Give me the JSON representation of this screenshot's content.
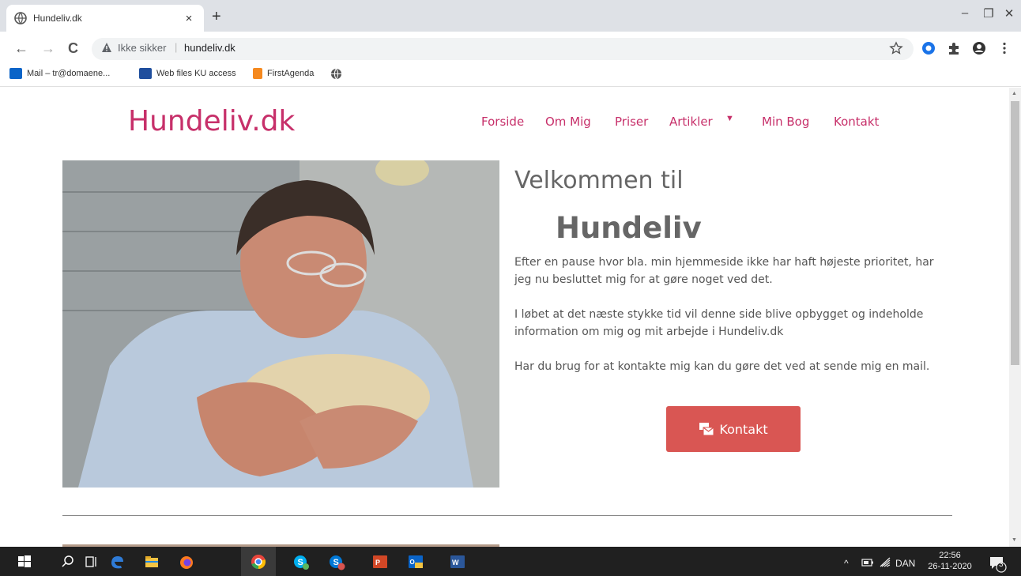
{
  "browser": {
    "tab_title": "Hundeliv.dk",
    "tab_close": "×",
    "new_tab": "+",
    "window_controls": [
      "–",
      "❐",
      "✕"
    ],
    "nav": {
      "back": "←",
      "forward": "→",
      "reload": "C"
    },
    "security_label": "Ikke sikker",
    "url_separator": "|",
    "url": "hundeliv.dk",
    "bookmarks": [
      {
        "label": "Mail – tr@domaene...",
        "icon": "outlook-icon",
        "color": "#0a64c8"
      },
      {
        "label": "Web files KU access",
        "icon": "ku-icon",
        "color": "#1f4e9d"
      },
      {
        "label": "FirstAgenda",
        "icon": "firstagenda-icon",
        "color": "#f5891f"
      },
      {
        "label": "",
        "icon": "globe-icon",
        "color": "#555555"
      }
    ]
  },
  "site": {
    "logo": "Hundeliv.dk",
    "nav": [
      "Forside",
      "Om Mig",
      "Priser",
      "Artikler",
      "Min Bog",
      "Kontakt"
    ],
    "nav_caret": "▼",
    "heading_line1": "Velkommen til",
    "heading_line2": "Hundeliv",
    "paragraphs": [
      "Efter en pause hvor bla. min hjemmeside ikke har haft højeste prioritet, har jeg nu besluttet mig for at gøre noget ved det.",
      "I løbet at det næste stykke tid vil denne side blive opbygget og indeholde information om mig og mit arbejde i Hundeliv.dk",
      "Har du brug for at kontakte mig kan du gøre det ved at sende mig en mail."
    ],
    "contact_button": "Kontakt",
    "brand_color": "#c7306a",
    "button_color": "#d95653"
  },
  "taskbar": {
    "apps": [
      {
        "name": "start-icon",
        "color": "#ffffff"
      },
      {
        "name": "search-icon",
        "color": "#ffffff"
      },
      {
        "name": "task-view-icon",
        "color": "#ffffff"
      },
      {
        "name": "edge-icon",
        "color": "#2f7bd6"
      },
      {
        "name": "file-explorer-icon",
        "color": "#f3c443"
      },
      {
        "name": "firefox-icon",
        "color": "#ff7a1f"
      },
      {
        "name": "chrome-icon",
        "color": "#e8453c"
      },
      {
        "name": "skype-icon",
        "color": "#00aff0"
      },
      {
        "name": "skype-business-icon",
        "color": "#0078d7"
      },
      {
        "name": "powerpoint-icon",
        "color": "#d24726"
      },
      {
        "name": "outlook-icon",
        "color": "#0a64c8"
      },
      {
        "name": "word-icon",
        "color": "#2b579a"
      }
    ],
    "tray_chevron": "^",
    "language": "DAN",
    "time": "22:56",
    "date": "26-11-2020",
    "notification_count": "3"
  }
}
